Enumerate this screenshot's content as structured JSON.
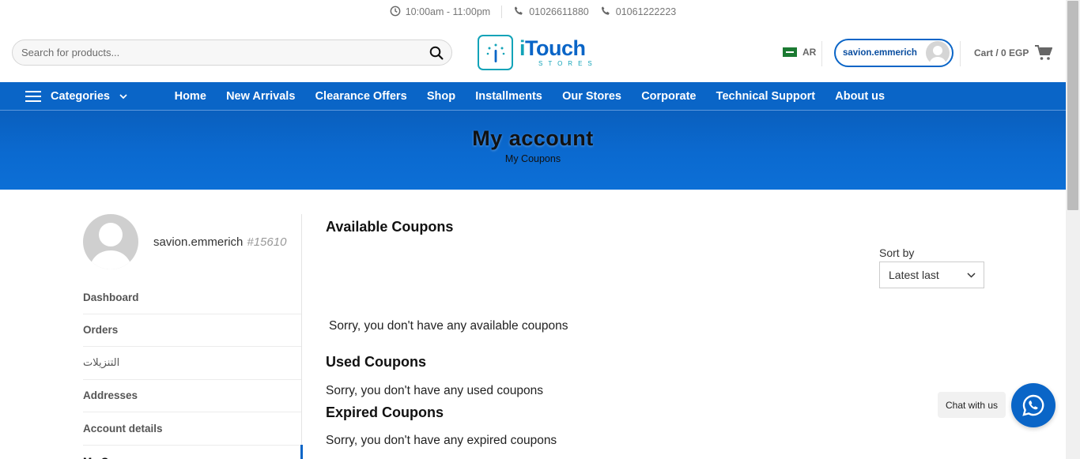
{
  "topbar": {
    "hours": "10:00am - 11:00pm",
    "phone1": "01026611880",
    "phone2": "01061222223"
  },
  "search": {
    "placeholder": "Search for products..."
  },
  "logo": {
    "brand_prefix": "i",
    "brand_rest": "Touch",
    "subtitle": "STORES"
  },
  "header": {
    "language": "AR",
    "username": "savion.emmerich",
    "cart_label": "Cart / 0 EGP"
  },
  "nav": {
    "categories_label": "Categories",
    "items": [
      "Home",
      "New Arrivals",
      "Clearance Offers",
      "Shop",
      "Installments",
      "Our Stores",
      "Corporate",
      "Technical Support",
      "About us"
    ]
  },
  "band": {
    "title": "My account",
    "crumb": "My Coupons"
  },
  "sidebar": {
    "name": "savion.emmerich",
    "user_id": "#15610",
    "items": [
      "Dashboard",
      "Orders",
      "التنزيلات",
      "Addresses",
      "Account details",
      "My C..."
    ]
  },
  "content": {
    "available_title": "Available Coupons",
    "available_empty": "Sorry, you don't have any available coupons",
    "used_title": "Used Coupons",
    "used_empty": "Sorry, you don't have any used coupons",
    "expired_title": "Expired Coupons",
    "expired_empty": "Sorry, you don't have any expired coupons"
  },
  "sort": {
    "label": "Sort by",
    "selected": "Latest last"
  },
  "chat": {
    "label": "Chat with us"
  },
  "colors": {
    "primary": "#0a65c7",
    "accent": "#12a3b8",
    "whatsapp_bg": "#0a65c7"
  },
  "icons": [
    "clock-icon",
    "phone-icon",
    "search-icon",
    "flag-icon",
    "avatar-icon",
    "cart-icon",
    "hamburger-icon",
    "chevron-down-icon",
    "whatsapp-icon"
  ]
}
